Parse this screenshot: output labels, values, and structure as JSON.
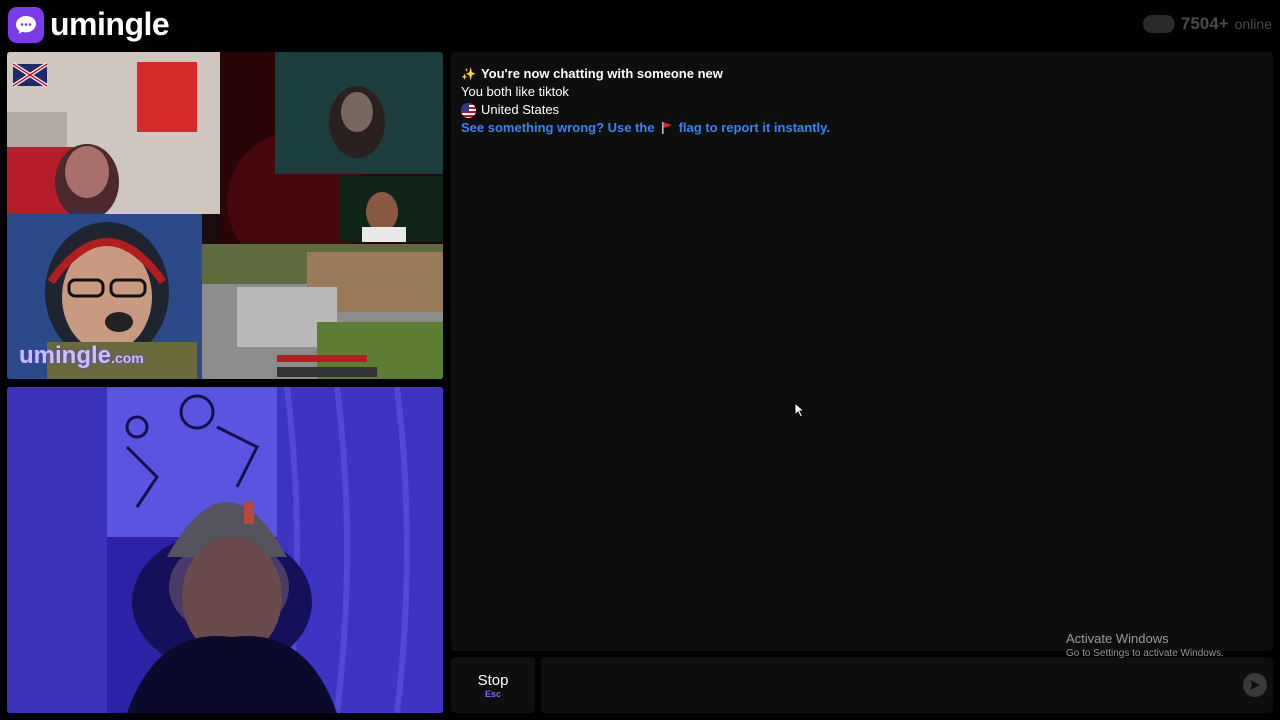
{
  "header": {
    "app_name": "umingle",
    "online_count": "7504+",
    "online_label": "online"
  },
  "videos": {
    "stranger_watermark": "umingle",
    "stranger_watermark_suffix": ".com"
  },
  "chat": {
    "messages": [
      {
        "icon": "sparkles-icon",
        "text": "You're now chatting with someone new",
        "style": "bold"
      },
      {
        "text": "You both like tiktok",
        "style": "normal"
      },
      {
        "icon": "us-flag-icon",
        "text": "United States",
        "style": "normal"
      },
      {
        "text_before": "See something wrong? Use the",
        "icon": "red-flag-icon",
        "text_after": "flag to report it instantly.",
        "style": "link"
      }
    ]
  },
  "controls": {
    "stop_label": "Stop",
    "stop_shortcut": "Esc",
    "input_value": "",
    "input_placeholder": ""
  },
  "overlay": {
    "activate_title": "Activate Windows",
    "activate_subtitle": "Go to Settings to activate Windows."
  },
  "colors": {
    "accent": "#7c3aed",
    "link": "#3b82f6",
    "panel": "#0e0e0e"
  }
}
